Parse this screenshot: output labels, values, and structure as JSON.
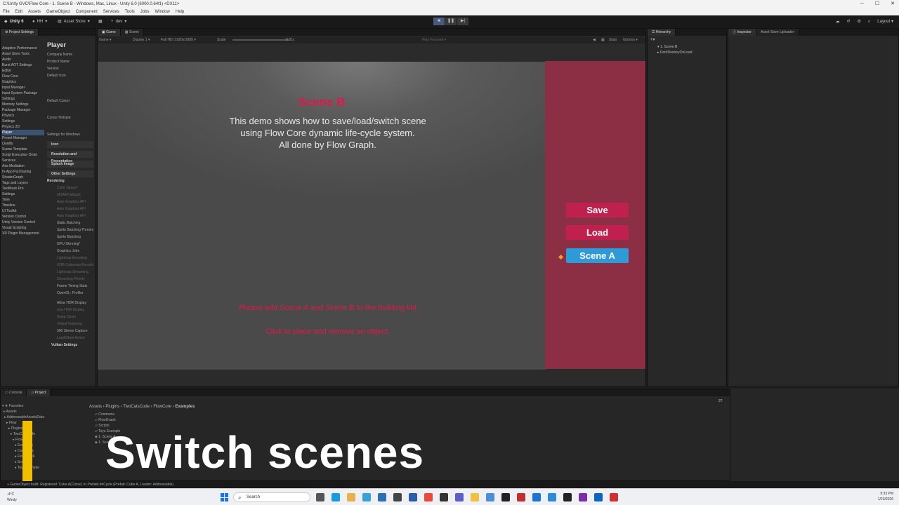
{
  "window": {
    "title": "C:\\Unity GVC\\Flow Core - 1. Scene B - Windows, Mac, Linux - Unity 6.0 (6000.0.64f1) <DX11>"
  },
  "menu": [
    "File",
    "Edit",
    "Assets",
    "GameObject",
    "Component",
    "Services",
    "Tools",
    "Jobs",
    "Window",
    "Help"
  ],
  "toolbar": {
    "unity_label": "Unity 6",
    "account": "HH",
    "asset_store": "Asset Store",
    "branch": "dev",
    "layout": "Layout"
  },
  "project_settings": {
    "tab": "Project Settings",
    "categories": [
      "Adaptive Performance",
      "Asset Store Tools",
      "Audio",
      "Burst AOT Settings",
      "Editor",
      "Flow Core",
      "Graphics",
      "Input Manager",
      "Input System Package",
      "Settings",
      "Memory Settings",
      "Package Manager",
      "Physics",
      "Settings",
      "Physics 2D",
      "Player",
      "Preset Manager",
      "Quality",
      "Scene Template",
      "Script Execution Order",
      "Services",
      "Ads Mediation",
      "In-App Purchasing",
      "ShaderGraph",
      "Tags and Layers",
      "TextMesh Pro",
      "Settings",
      "Time",
      "Timeline",
      "UI Toolkit",
      "Version Control",
      "Unity Version Control",
      "Visual Scripting",
      "XR Plugin Management"
    ],
    "selected_index": 15,
    "player_heading": "Player",
    "fields": [
      "Company Name",
      "Product Name",
      "Version",
      "Default Icon",
      "Default Cursor",
      "Cursor Hotspot"
    ],
    "settings_for": "Settings for Windows",
    "sections": [
      "Icon",
      "Resolution and Presentation",
      "Splash Image",
      "Other Settings"
    ],
    "rendering_label": "Rendering",
    "rendering_items": [
      "Color Space*",
      "MSAA Fallback",
      "Auto Graphics API",
      "Auto Graphics API",
      "Auto Graphics API",
      "Static Batching",
      "Sprite Batching Threshold",
      "Sprite Batching",
      "GPU Skinning*",
      "Graphics Jobs",
      "Lightmap Encoding",
      "HDR Cubemap Encoding",
      "Lightmap Streaming",
      "Streaming Priority",
      "Frame Timing Stats",
      "OpenGL: Profiler"
    ],
    "extra_items": [
      "Allow HDR Display",
      "Use HDR Display",
      "Swap Chain",
      "Virtual Texturing",
      "360 Stereo Capture",
      "Load/Store Action"
    ],
    "vulkan": "Vulkan Settings"
  },
  "game_view": {
    "tabs": [
      "Game",
      "Scene"
    ],
    "mode": "Game",
    "display": "Display 1",
    "resolution": "Full HD (1920x1080)",
    "scale_label": "Scale",
    "scale_value": "0.81x",
    "play_focused": "Play Focused",
    "stats": "Stats",
    "gizmos": "Gizmos"
  },
  "scene": {
    "title": "Scene B",
    "description": "This demo shows how to save/load/switch scene\nusing Flow Core dynamic life-cycle system.\nAll done by Flow Graph.",
    "hint_build": "Please add Scene A and Scene B to the building list",
    "hint_click": "Click to place and remove an object.",
    "buttons": {
      "save": "Save",
      "load": "Load",
      "scene_a": "Scene A"
    }
  },
  "hierarchy": {
    "tab": "Hierarchy",
    "items": [
      "1. Scene B",
      "DontDestroyOnLoad"
    ]
  },
  "inspector": {
    "tabs": [
      "Inspector",
      "Asset Store Uploader"
    ]
  },
  "bottom": {
    "tabs": [
      "Console",
      "Project"
    ],
    "favorites": "Favorites",
    "tree": [
      "Assets",
      "AddressableAssetsData",
      "Flow",
      "Plugins",
      "TwoCatsCode",
      "FlowCore",
      "Examples",
      "Commons",
      "FlowGraph",
      "Scripts",
      "Toys Example"
    ],
    "breadcrumb": [
      "Assets",
      "Plugins",
      "TwoCatsCode",
      "FlowCore",
      "Examples"
    ],
    "files": [
      "Commons",
      "FlowGraph",
      "Scripts",
      "Toys Example",
      "1. Scene A",
      "1. Scene B"
    ],
    "count": "27"
  },
  "caption": "Switch scenes",
  "status": "GameObject.build: Registered 'Cube A(Clone)' to PrefabLifeCycle (Prefab: Cube A, Loader: Addressable)",
  "taskbar": {
    "search": "Search",
    "weather_temp": "-4°C",
    "weather_desc": "Windy",
    "time": "9:33 PM",
    "date": "1/23/2026"
  },
  "colors": {
    "accent_red": "#c0204e",
    "accent_blue": "#2f9ad8",
    "side_panel": "#8c2f45",
    "caption_bar": "#f0c000"
  }
}
